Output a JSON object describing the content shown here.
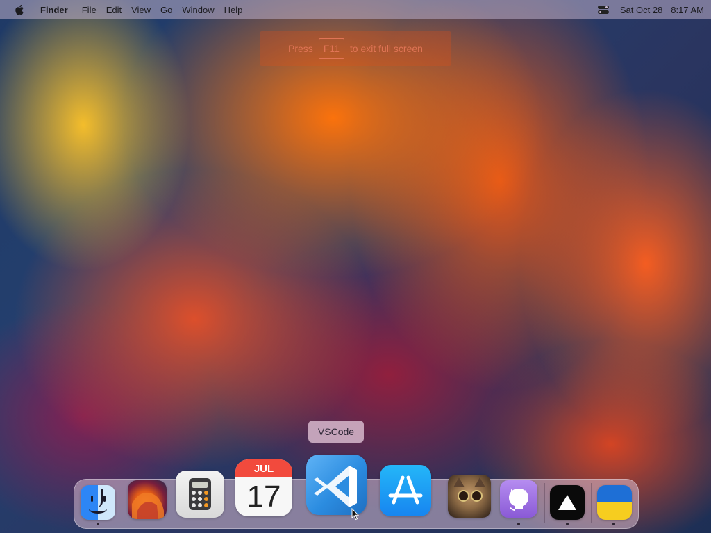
{
  "menubar": {
    "apple_icon": "apple-logo-icon",
    "app_name": "Finder",
    "items": [
      "File",
      "Edit",
      "View",
      "Go",
      "Window",
      "Help"
    ],
    "control_center_icon": "control-center-icon",
    "date": "Sat Oct 28",
    "time": "8:17 AM"
  },
  "fullscreen_banner": {
    "prefix": "Press",
    "key": "F11",
    "suffix": "to exit full screen"
  },
  "tooltip": {
    "label": "VSCode"
  },
  "dock": {
    "apps": [
      {
        "name": "Finder",
        "icon": "finder-icon",
        "running": true
      },
      {
        "name": "Ventura",
        "icon": "ventura-wallpaper-icon",
        "running": false
      },
      {
        "name": "Calculator",
        "icon": "calculator-icon",
        "running": false
      },
      {
        "name": "Calendar",
        "icon": "calendar-icon",
        "running": false,
        "month": "JUL",
        "day": "17"
      },
      {
        "name": "VSCode",
        "icon": "vscode-icon",
        "running": false
      },
      {
        "name": "App Store",
        "icon": "app-store-icon",
        "running": false
      },
      {
        "name": "Cat",
        "icon": "cat-photo-icon",
        "running": false
      },
      {
        "name": "GitHub",
        "icon": "github-icon",
        "running": true
      },
      {
        "name": "Vercel",
        "icon": "vercel-triangle-icon",
        "running": true
      },
      {
        "name": "Ukraine",
        "icon": "ukraine-flag-icon",
        "running": true
      }
    ]
  },
  "colors": {
    "calendar_red": "#f24a3d",
    "vscode_blue": "#2b8ce0",
    "appstore_blue": "#1785f0",
    "github_purple": "#8a5ad6"
  }
}
